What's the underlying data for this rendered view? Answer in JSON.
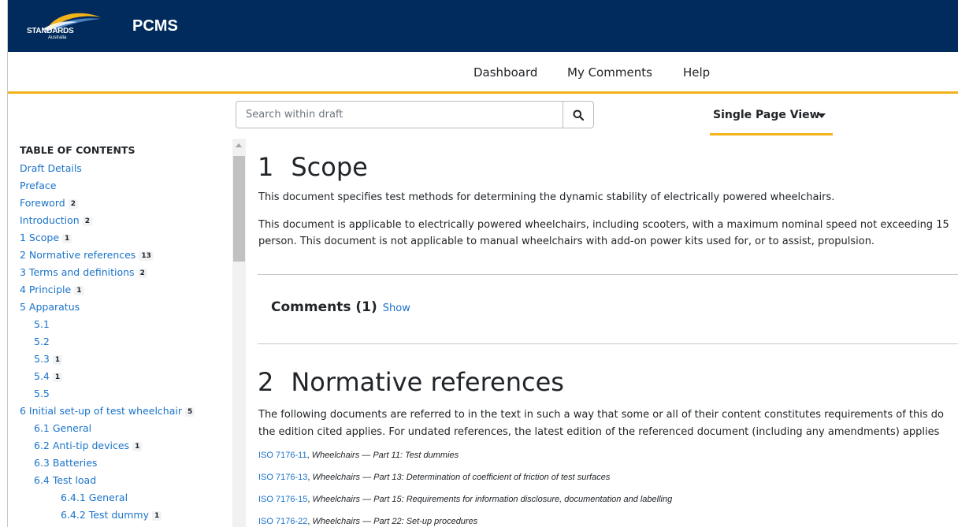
{
  "header": {
    "logo_text": "STANDARDS",
    "logo_sub": "Australia",
    "app_title": "PCMS"
  },
  "nav": {
    "items": [
      "Dashboard",
      "My Comments",
      "Help"
    ]
  },
  "toolbar": {
    "search_placeholder": "Search within draft",
    "view_mode": "Single Page View"
  },
  "toc": {
    "title": "TABLE OF CONTENTS",
    "items": [
      {
        "label": "Draft Details",
        "badge": ""
      },
      {
        "label": "Preface",
        "badge": ""
      },
      {
        "label": "Foreword",
        "badge": "2"
      },
      {
        "label": "Introduction",
        "badge": "2"
      },
      {
        "label": "1 Scope",
        "badge": "1"
      },
      {
        "label": "2 Normative references",
        "badge": "13"
      },
      {
        "label": "3 Terms and definitions",
        "badge": "2"
      },
      {
        "label": "4 Principle",
        "badge": "1"
      },
      {
        "label": "5 Apparatus",
        "badge": ""
      },
      {
        "label": "5.1",
        "badge": ""
      },
      {
        "label": "5.2",
        "badge": ""
      },
      {
        "label": "5.3",
        "badge": "1"
      },
      {
        "label": "5.4",
        "badge": "1"
      },
      {
        "label": "5.5",
        "badge": ""
      },
      {
        "label": "6 Initial set-up of test wheelchair",
        "badge": "5"
      },
      {
        "label": "6.1 General",
        "badge": ""
      },
      {
        "label": "6.2 Anti-tip devices",
        "badge": "1"
      },
      {
        "label": "6.3 Batteries",
        "badge": ""
      },
      {
        "label": "6.4 Test load",
        "badge": ""
      },
      {
        "label": "6.4.1 General",
        "badge": ""
      },
      {
        "label": "6.4.2 Test dummy",
        "badge": "1"
      }
    ]
  },
  "content": {
    "section1": {
      "number": "1",
      "title": "Scope",
      "para1": "This document specifies test methods for determining the dynamic stability of electrically powered wheelchairs.",
      "para2_line1": "This document is applicable to electrically powered wheelchairs, including scooters, with a maximum nominal speed not exceeding 15",
      "para2_line2": "person. This document is not applicable to manual wheelchairs with add-on power kits used for, or to assist, propulsion."
    },
    "comments": {
      "label": "Comments (1)",
      "show": "Show"
    },
    "section2": {
      "number": "2",
      "title": "Normative references",
      "para_line1": "The following documents are referred to in the text in such a way that some or all of their content constitutes requirements of this do",
      "para_line2": "the edition cited applies. For undated references, the latest edition of the referenced document (including any amendments) applies",
      "refs": [
        {
          "code": "ISO 7176-11",
          "title": "Wheelchairs — Part 11: Test dummies"
        },
        {
          "code": "ISO 7176-13",
          "title": "Wheelchairs — Part 13: Determination of coefficient of friction of test surfaces"
        },
        {
          "code": "ISO 7176-15",
          "title": "Wheelchairs — Part 15: Requirements for information disclosure, documentation and labelling"
        },
        {
          "code": "ISO 7176-22",
          "title": "Wheelchairs — Part 22: Set-up procedures"
        }
      ]
    }
  },
  "colors": {
    "header_bg": "#002b5c",
    "accent": "#f2b31b",
    "link": "#1a73c9"
  },
  "icons": {
    "search": "search-icon",
    "dropdown": "caret-down-icon"
  }
}
